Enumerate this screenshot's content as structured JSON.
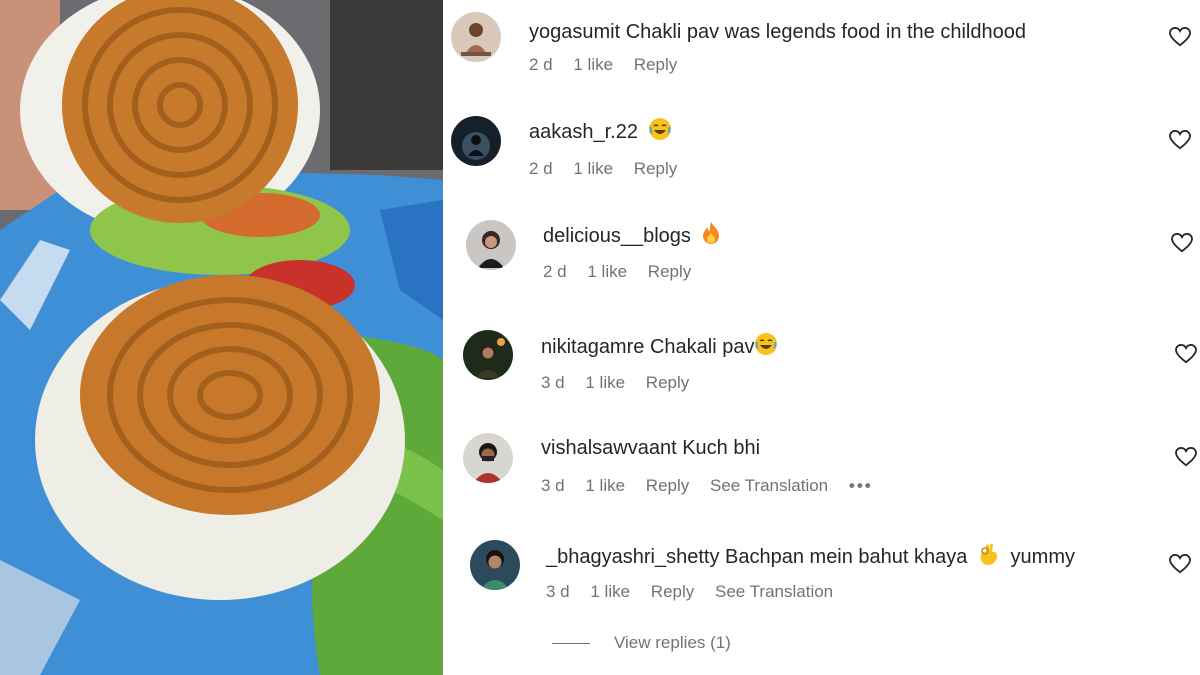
{
  "photo": {
    "icon": "food-photo-chakli-pav"
  },
  "comments": [
    {
      "username": "yogasumit",
      "text": "Chakli pav was legends food in the childhood",
      "emoji": "",
      "time": "2 d",
      "likes": "1 like",
      "reply": "Reply",
      "translation": ""
    },
    {
      "username": "aakash_r.22",
      "text": "",
      "emoji": "laughing-emoji",
      "time": "2 d",
      "likes": "1 like",
      "reply": "Reply",
      "translation": ""
    },
    {
      "username": "delicious__blogs",
      "text": "",
      "emoji": "fire-emoji",
      "time": "2 d",
      "likes": "1 like",
      "reply": "Reply",
      "translation": ""
    },
    {
      "username": "nikitagamre",
      "text": "Chakali pav",
      "emoji": "laughing-emoji",
      "time": "3 d",
      "likes": "1 like",
      "reply": "Reply",
      "translation": ""
    },
    {
      "username": "vishalsawvaant",
      "text": "Kuch bhi",
      "emoji": "",
      "time": "3 d",
      "likes": "1 like",
      "reply": "Reply",
      "translation": "See Translation",
      "more": "•••"
    },
    {
      "username": "_bhagyashri_shetty",
      "text": "Bachpan mein bahut khaya",
      "emoji": "ok-hand-emoji",
      "after_text": "yummy",
      "time": "3 d",
      "likes": "1 like",
      "reply": "Reply",
      "translation": "See Translation"
    }
  ],
  "view_replies": "View replies (1)",
  "colors": {
    "text": "#262626",
    "meta": "#737373",
    "background": "#ffffff"
  }
}
